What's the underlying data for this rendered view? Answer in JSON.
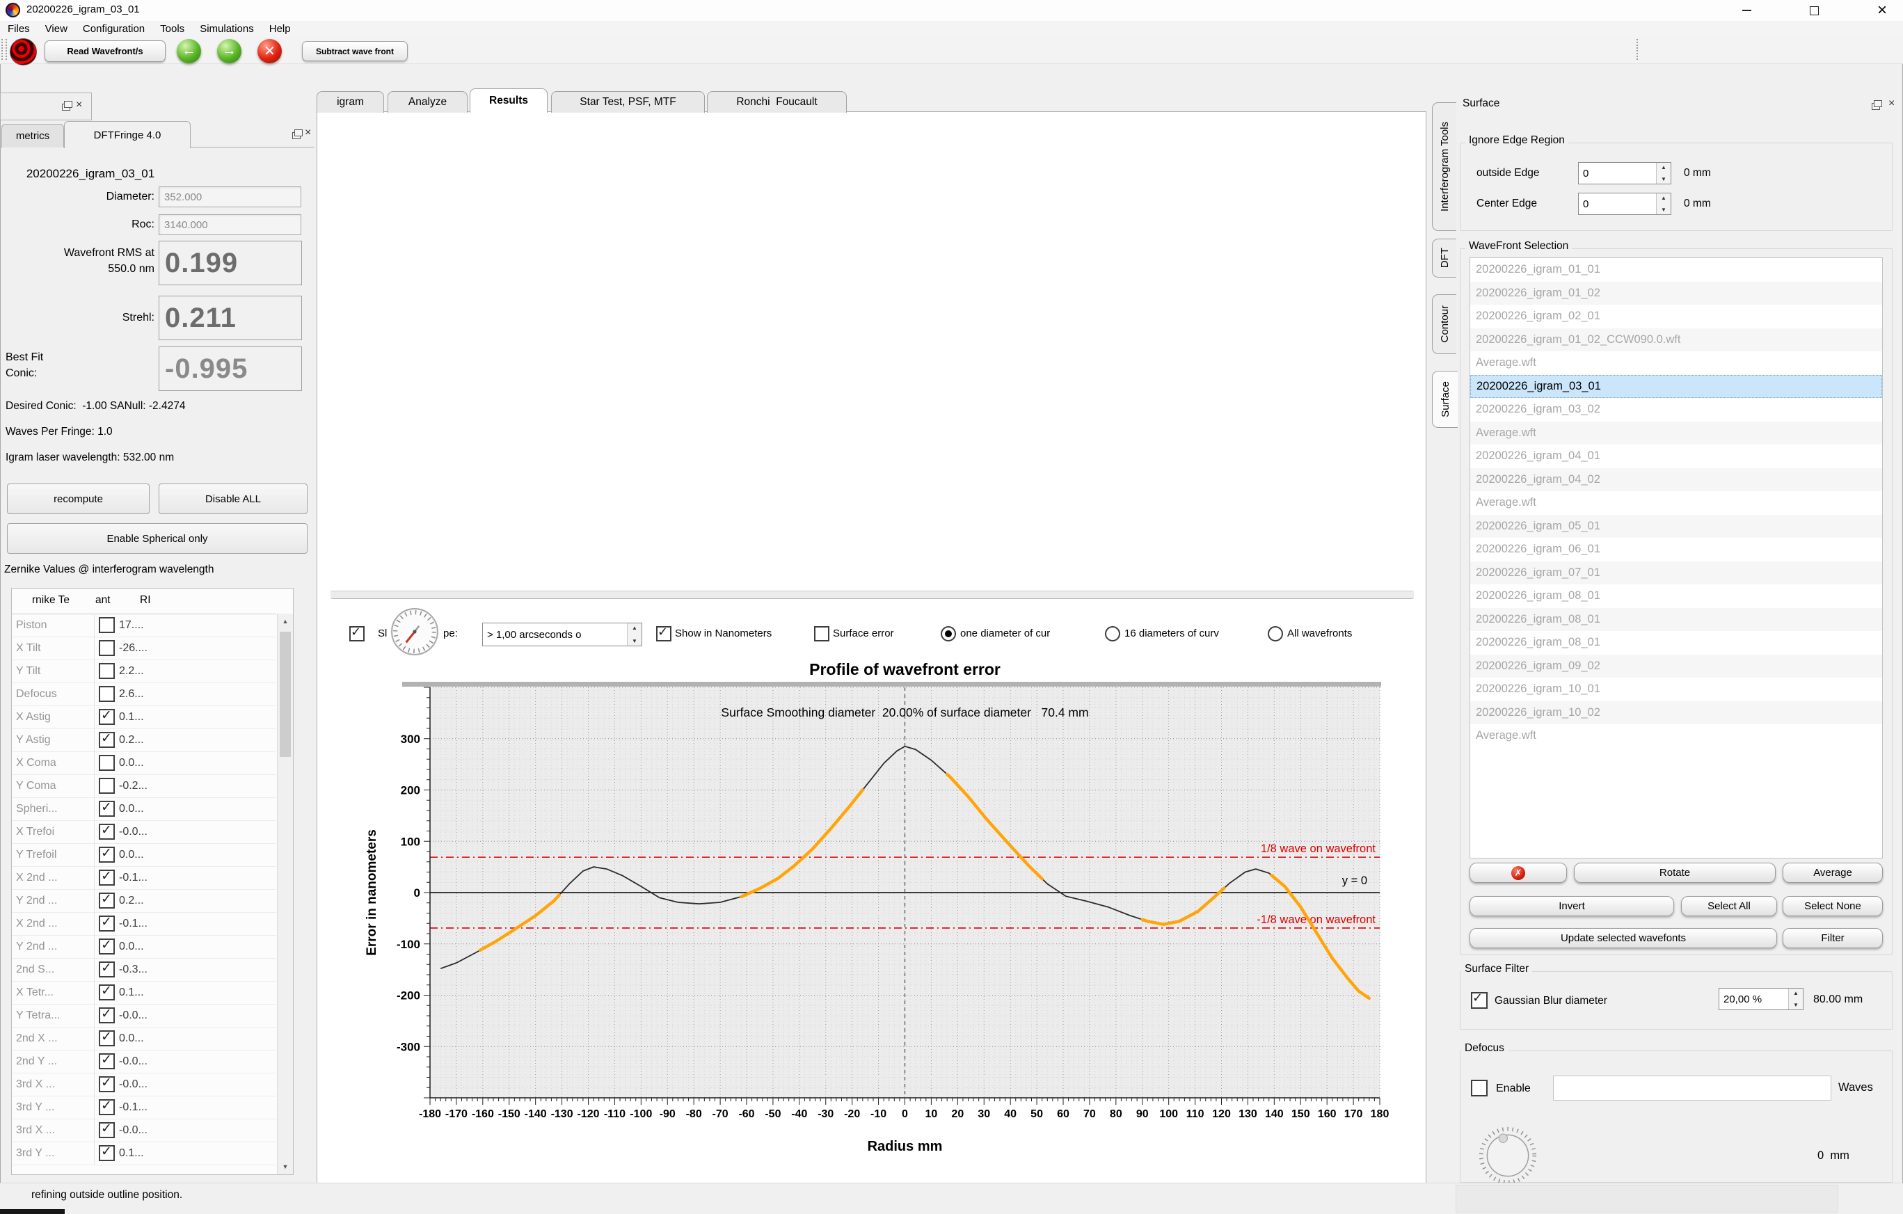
{
  "window": {
    "title": "20200226_igram_03_01",
    "menus": [
      "Files",
      "View",
      "Configuration",
      "Tools",
      "Simulations",
      "Help"
    ]
  },
  "toolbar": {
    "read_wavefronts": "Read Wavefront/s",
    "subtract_wavefront": "Subtract wave front"
  },
  "metrics_panel": {
    "tab_metrics": "metrics",
    "tab_dftfringe": "DFTFringe 4.0",
    "wavefront_name": "20200226_igram_03_01",
    "diameter_label": "Diameter:",
    "diameter_value": "352.000",
    "roc_label": "Roc:",
    "roc_value": "3140.000",
    "rms_label_line1": "Wavefront RMS at",
    "rms_label_line2": "550.0 nm",
    "rms_value": "0.199",
    "strehl_label": "Strehl:",
    "strehl_value": "0.211",
    "conic_label_line1": "Best Fit",
    "conic_label_line2": "Conic:",
    "conic_value": "-0.995",
    "desired_conic": "Desired Conic:  -1.00 SANull: -2.4274",
    "waves_per_fringe": "Waves Per Fringe: 1.0",
    "igram_wavelength": "Igram laser wavelength: 532.00 nm",
    "recompute_button": "recompute",
    "disable_all_button": "Disable ALL",
    "enable_spherical_button": "Enable Spherical only",
    "zernike_title": "Zernike Values @ interferogram wavelength",
    "zernike_col1": "rnike Te",
    "zernike_col2": "ant",
    "zernike_col3": "RI",
    "zernike_rows": [
      {
        "term": "Piston",
        "checked": false,
        "value": "17...."
      },
      {
        "term": "X Tilt",
        "checked": false,
        "value": "-26...."
      },
      {
        "term": "Y Tilt",
        "checked": false,
        "value": "2.2..."
      },
      {
        "term": "Defocus",
        "checked": false,
        "value": "2.6..."
      },
      {
        "term": "X Astig",
        "checked": true,
        "value": "0.1..."
      },
      {
        "term": "Y Astig",
        "checked": true,
        "value": "0.2..."
      },
      {
        "term": "X Coma",
        "checked": false,
        "value": "0.0..."
      },
      {
        "term": "Y Coma",
        "checked": false,
        "value": "-0.2..."
      },
      {
        "term": "Spheri...",
        "checked": true,
        "value": "0.0..."
      },
      {
        "term": "X Trefoi",
        "checked": true,
        "value": "-0.0..."
      },
      {
        "term": "Y Trefoil",
        "checked": true,
        "value": "0.0..."
      },
      {
        "term": "X 2nd ...",
        "checked": true,
        "value": "-0.1..."
      },
      {
        "term": "Y 2nd ...",
        "checked": true,
        "value": "0.2..."
      },
      {
        "term": "X 2nd ...",
        "checked": true,
        "value": "-0.1..."
      },
      {
        "term": "Y 2nd ...",
        "checked": true,
        "value": "0.0..."
      },
      {
        "term": "2nd S...",
        "checked": true,
        "value": "-0.3..."
      },
      {
        "term": "X Tetr...",
        "checked": true,
        "value": "0.1..."
      },
      {
        "term": "Y Tetra...",
        "checked": true,
        "value": "-0.0..."
      },
      {
        "term": "2nd X ...",
        "checked": true,
        "value": "0.0..."
      },
      {
        "term": "2nd Y ...",
        "checked": true,
        "value": "-0.0..."
      },
      {
        "term": "3rd X ...",
        "checked": true,
        "value": "-0.0..."
      },
      {
        "term": "3rd Y ...",
        "checked": true,
        "value": "-0.1..."
      },
      {
        "term": "3rd X ...",
        "checked": true,
        "value": "-0.0..."
      },
      {
        "term": "3rd Y ...",
        "checked": true,
        "value": "0.1..."
      }
    ]
  },
  "center": {
    "tabs": [
      "igram",
      "Analyze",
      "Results",
      "Star Test, PSF, MTF",
      "Ronchi  Foucault"
    ],
    "active_tab": "Results",
    "slope_label_left": "Sl",
    "slope_label_right": "pe:",
    "slope_value": "> 1,00 arcseconds o",
    "show_nm_label": "Show in Nanometers",
    "surface_error_label": "Surface error",
    "radio_one_diameter": "one diameter of cur",
    "radio_16_diameters": "16 diameters of curv",
    "radio_all_wavefronts": "All wavefronts"
  },
  "chart_data": {
    "type": "line",
    "title": "Profile of wavefront error",
    "annotation_smoothing": "Surface Smoothing diameter  20.00% of surface diameter   70.4 mm",
    "xlabel": "Radius mm",
    "ylabel": "Error in nanometers",
    "xlim": [
      -180,
      180
    ],
    "ylim": [
      -400,
      400
    ],
    "x_tick_step": 10,
    "y_ticks": [
      300,
      200,
      100,
      0,
      -100,
      -200,
      -300
    ],
    "grid": true,
    "legend_position": "none",
    "reference_lines": [
      {
        "y": 69,
        "label": "1/8 wave on wavefront",
        "color": "#dd0000",
        "style": "dashed"
      },
      {
        "y": 0,
        "label": "y = 0",
        "color": "#000000",
        "style": "solid"
      },
      {
        "y": -69,
        "label": "-1/8 wave on wavefront",
        "color": "#dd0000",
        "style": "dashed"
      }
    ],
    "vertical_line_x": 0,
    "series": [
      {
        "name": "wavefront error profile",
        "color": "#2b2b2b",
        "highlight_color": "#ffa50a",
        "highlight_ranges": [
          [
            -161,
            -131
          ],
          [
            -62,
            -16
          ],
          [
            16,
            52
          ],
          [
            90,
            121
          ],
          [
            139,
            176
          ]
        ],
        "points": [
          [
            -176,
            -148
          ],
          [
            -170,
            -137
          ],
          [
            -163,
            -118
          ],
          [
            -155,
            -95
          ],
          [
            -148,
            -72
          ],
          [
            -140,
            -45
          ],
          [
            -133,
            -16
          ],
          [
            -127,
            18
          ],
          [
            -122,
            42
          ],
          [
            -118,
            50
          ],
          [
            -113,
            46
          ],
          [
            -107,
            33
          ],
          [
            -100,
            12
          ],
          [
            -93,
            -10
          ],
          [
            -86,
            -19
          ],
          [
            -78,
            -22
          ],
          [
            -70,
            -19
          ],
          [
            -62,
            -8
          ],
          [
            -55,
            8
          ],
          [
            -48,
            28
          ],
          [
            -42,
            52
          ],
          [
            -35,
            85
          ],
          [
            -28,
            125
          ],
          [
            -21,
            168
          ],
          [
            -14,
            213
          ],
          [
            -8,
            252
          ],
          [
            -3,
            276
          ],
          [
            0,
            285
          ],
          [
            4,
            279
          ],
          [
            10,
            258
          ],
          [
            17,
            226
          ],
          [
            24,
            187
          ],
          [
            31,
            143
          ],
          [
            39,
            97
          ],
          [
            47,
            52
          ],
          [
            54,
            17
          ],
          [
            61,
            -7
          ],
          [
            69,
            -17
          ],
          [
            77,
            -28
          ],
          [
            85,
            -44
          ],
          [
            92,
            -56
          ],
          [
            98,
            -62
          ],
          [
            104,
            -56
          ],
          [
            111,
            -37
          ],
          [
            117,
            -10
          ],
          [
            123,
            18
          ],
          [
            129,
            40
          ],
          [
            133,
            46
          ],
          [
            138,
            38
          ],
          [
            144,
            12
          ],
          [
            150,
            -28
          ],
          [
            156,
            -78
          ],
          [
            162,
            -128
          ],
          [
            168,
            -168
          ],
          [
            172,
            -192
          ],
          [
            176,
            -206
          ]
        ]
      }
    ]
  },
  "surface_panel": {
    "vertical_tabs": [
      "Interferogram Tools",
      "DFT",
      "Contour",
      "Surface"
    ],
    "active_vertical_tab": "Surface",
    "header": "Surface",
    "ignore_edge": {
      "group_label": "Ignore Edge Region",
      "outside_label": "outside Edge",
      "outside_value": "0",
      "outside_mm": "0 mm",
      "center_label": "Center Edge",
      "center_value": "0",
      "center_mm": "0 mm"
    },
    "wavefront_selection": {
      "group_label": "WaveFront Selection",
      "selected_index": 5,
      "items": [
        "20200226_igram_01_01",
        "20200226_igram_01_02",
        "20200226_igram_02_01",
        "20200226_igram_01_02_CCW090.0.wft",
        "Average.wft",
        "20200226_igram_03_01",
        "20200226_igram_03_02",
        "Average.wft",
        "20200226_igram_04_01",
        "20200226_igram_04_02",
        "Average.wft",
        "20200226_igram_05_01",
        "20200226_igram_06_01",
        "20200226_igram_07_01",
        "20200226_igram_08_01",
        "20200226_igram_08_01",
        "20200226_igram_08_01",
        "20200226_igram_09_02",
        "20200226_igram_10_01",
        "20200226_igram_10_02",
        "Average.wft"
      ],
      "buttons": {
        "delete_icon": "x-circle-icon",
        "rotate": "Rotate",
        "average": "Average",
        "invert": "Invert",
        "select_all": "Select All",
        "select_none": "Select None",
        "update_selected": "Update selected wavefonts",
        "filter": "Filter"
      }
    },
    "surface_filter": {
      "group_label": "Surface Filter",
      "gaussian_label": "Gaussian Blur diameter",
      "gaussian_checked": true,
      "percent_value": "20,00 %",
      "mm_value": "80.00 mm"
    },
    "defocus": {
      "group_label": "Defocus",
      "enable_label": "Enable",
      "enable_checked": false,
      "input_value": "",
      "waves_label": "Waves",
      "mm_value": "0  mm"
    }
  },
  "status": {
    "text": "refining outside outline position."
  }
}
